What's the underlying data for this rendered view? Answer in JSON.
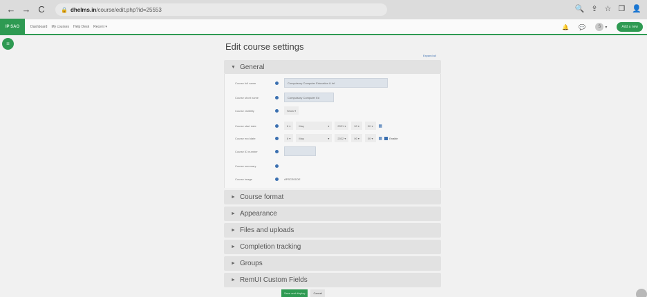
{
  "browser": {
    "back_icon": "←",
    "forward_icon": "→",
    "reload_icon": "C",
    "host": "dhelms.in",
    "path": "/course/edit.php?id=25553",
    "right_icons": [
      "🔍",
      "⇪",
      "☆",
      "❐",
      "👤"
    ]
  },
  "site_nav": {
    "logo": "IP SAO",
    "menu": [
      "Dashboard",
      "My courses",
      "Help Desk",
      "Recent ▾"
    ],
    "bell_icon": "🔔",
    "chat_icon": "💬",
    "avatar_initial": "S",
    "avatar_caret": "▾",
    "add_button": "Add a new"
  },
  "drawer_icon": "≡",
  "page": {
    "title": "Edit course settings",
    "expand_all": "Expand all"
  },
  "general": {
    "header": "General",
    "fields": {
      "full_name_label": "Course full name",
      "full_name_value": "Compulsory Computer Education & Inf",
      "short_name_label": "Course short name",
      "short_name_value": "Compulsory Computer Ed",
      "visibility_label": "Course visibility",
      "visibility_value": "Show ▾",
      "start_label": "Course start date",
      "start_day": "6 ▾",
      "start_month": "May",
      "start_month_caret": "▾",
      "start_year": "2021 ▾",
      "start_hour": "00 ▾",
      "start_min": "00 ▾",
      "end_label": "Course end date",
      "end_day": "6 ▾",
      "end_month": "May",
      "end_month_caret": "▾",
      "end_year": "2022 ▾",
      "end_hour": "00 ▾",
      "end_min": "00 ▾",
      "end_enable": "Enable",
      "id_label": "Course ID number",
      "summary_label": "Course summary",
      "image_label": "Course image",
      "image_value": "APSCE01DE"
    }
  },
  "sections": [
    "Course format",
    "Appearance",
    "Files and uploads",
    "Completion tracking",
    "Groups",
    "RemUI Custom Fields"
  ],
  "buttons": {
    "save": "Save and display",
    "cancel": "Cancel"
  },
  "colors": {
    "accent": "#2e9a52",
    "link": "#3a6fb0"
  }
}
